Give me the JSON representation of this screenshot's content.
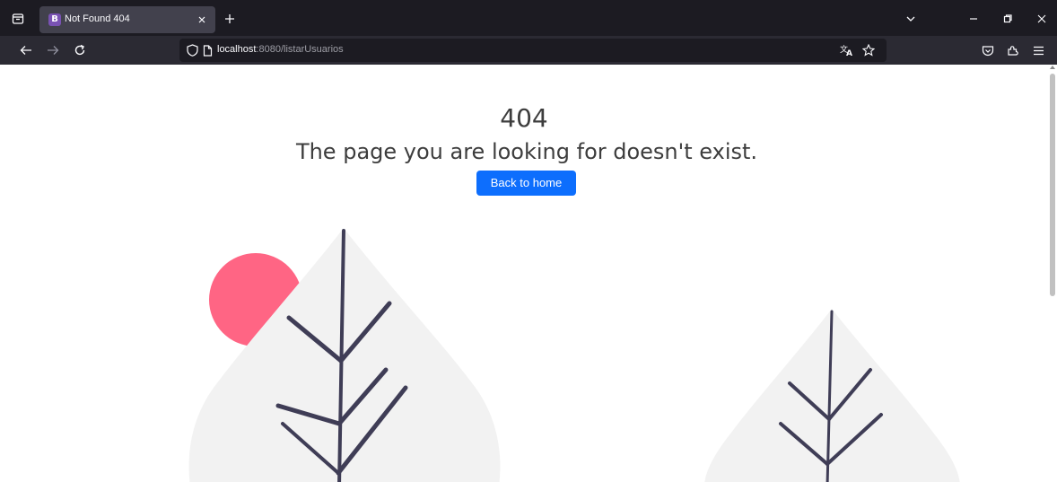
{
  "browser": {
    "tab": {
      "favicon_letter": "B",
      "title": "Not Found 404"
    },
    "url": {
      "host": "localhost",
      "rest": ":8080/listarUsuarios"
    }
  },
  "page": {
    "code": "404",
    "message": "The page you are looking for doesn't exist.",
    "button_label": "Back to home"
  },
  "colors": {
    "button": "#0d6efd",
    "sun": "#ff6584",
    "leaf": "#f2f2f2",
    "branch": "#3f3d56"
  }
}
